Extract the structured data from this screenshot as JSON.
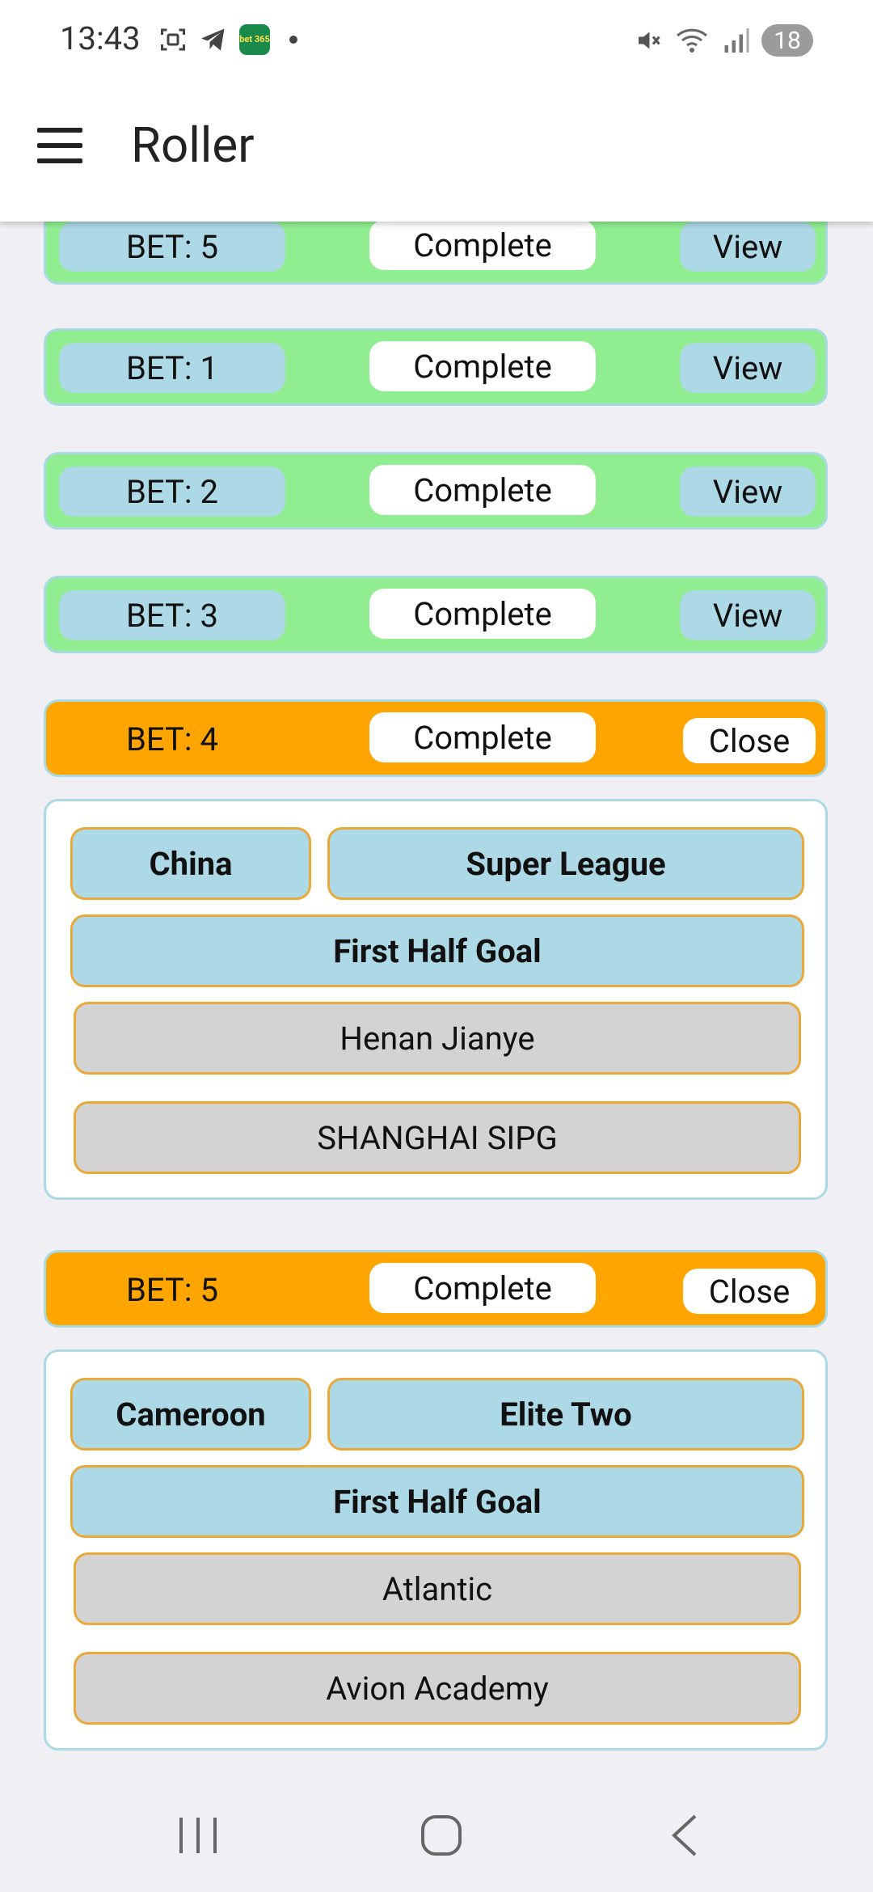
{
  "status_bar": {
    "time": "13:43",
    "app_badge": "bet 365",
    "battery": "18"
  },
  "app_bar": {
    "title": "Roller"
  },
  "bets_complete": [
    {
      "label": "BET: 5",
      "status": "Complete",
      "action": "View"
    },
    {
      "label": "BET: 1",
      "status": "Complete",
      "action": "View"
    },
    {
      "label": "BET: 2",
      "status": "Complete",
      "action": "View"
    },
    {
      "label": "BET: 3",
      "status": "Complete",
      "action": "View"
    }
  ],
  "bets_open": [
    {
      "label": "BET: 4",
      "status": "Complete",
      "action": "Close",
      "country": "China",
      "league": "Super League",
      "market": "First Half Goal",
      "home": "Henan Jianye",
      "away": "SHANGHAI SIPG"
    },
    {
      "label": "BET: 5",
      "status": "Complete",
      "action": "Close",
      "country": "Cameroon",
      "league": "Elite Two",
      "market": "First Half Goal",
      "home": "Atlantic",
      "away": "Avion Academy"
    }
  ],
  "colors": {
    "complete_row": "#90ee90",
    "open_row": "#ffa500",
    "chip": "#add8e6",
    "team": "#d3d3d3",
    "chip_border": "#e8a93a"
  }
}
